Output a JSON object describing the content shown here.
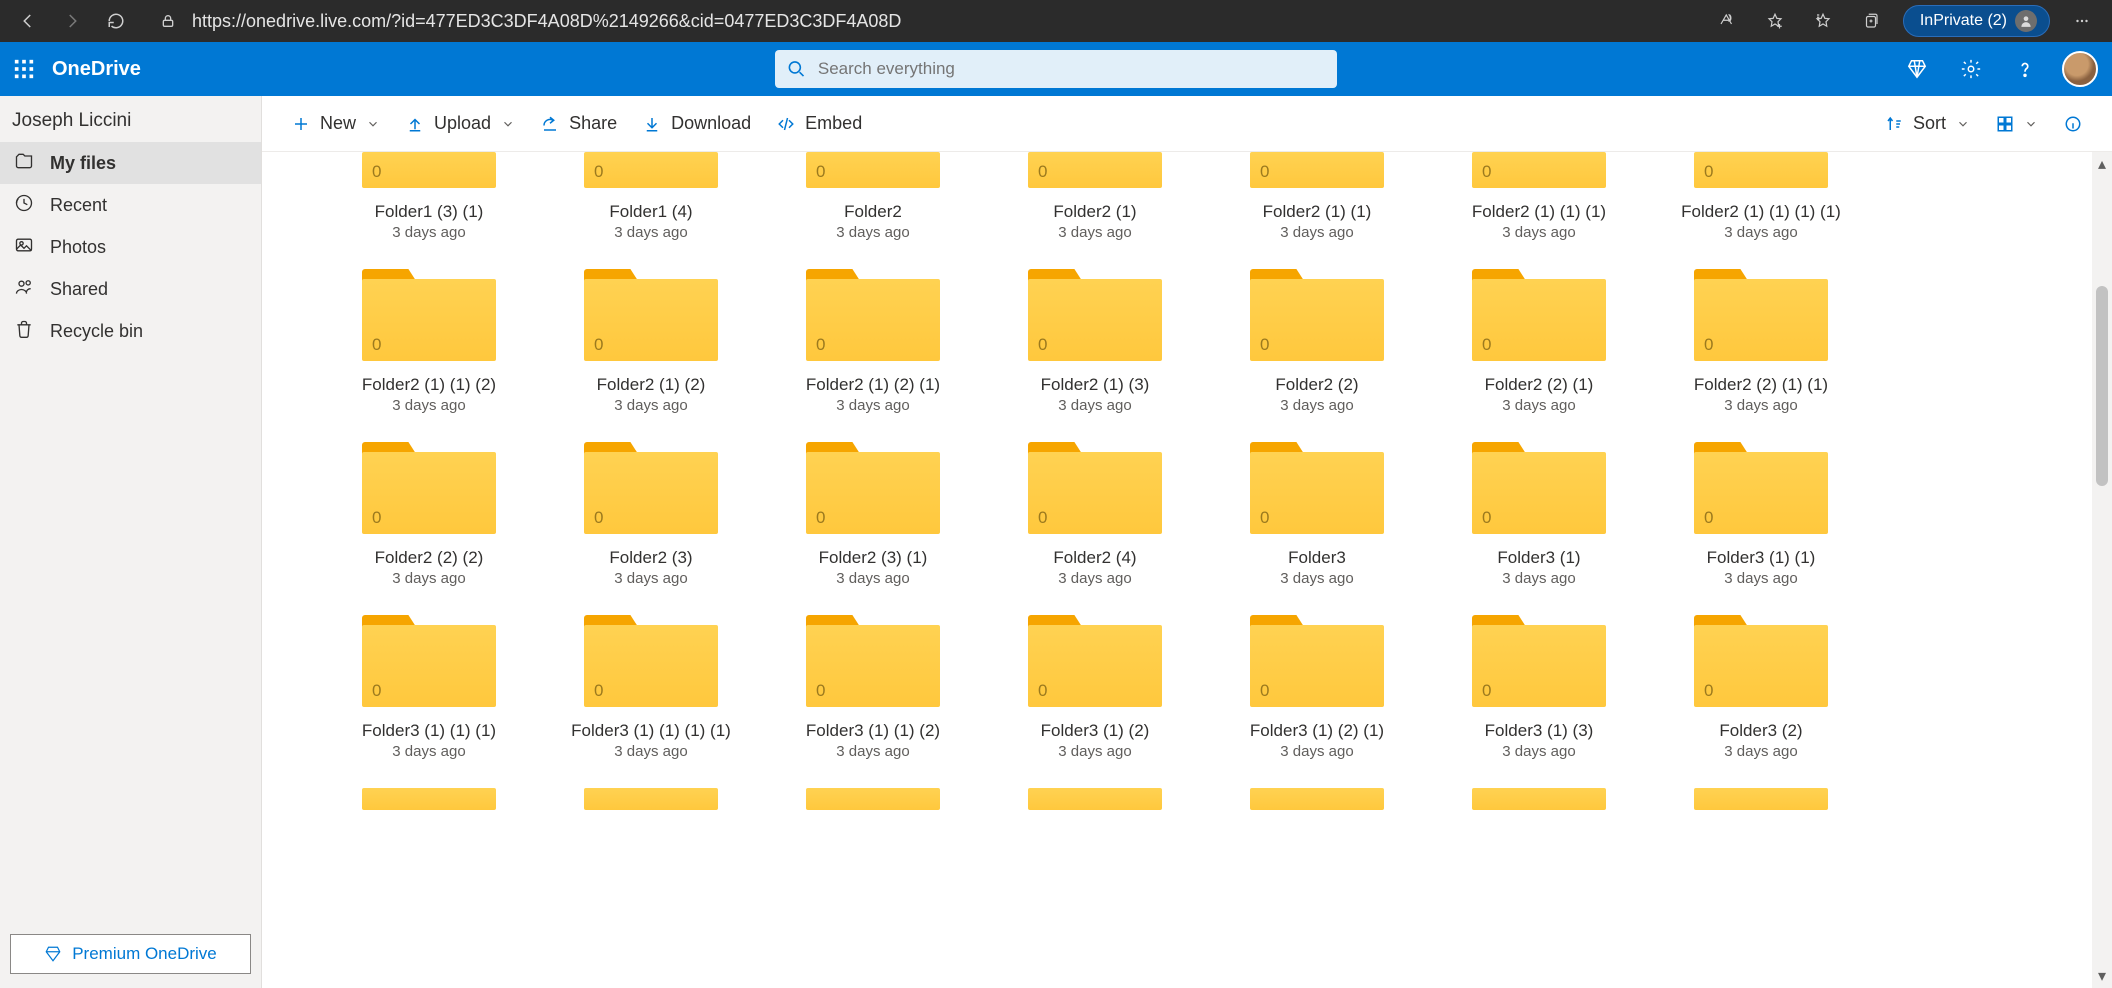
{
  "browser": {
    "url": "https://onedrive.live.com/?id=477ED3C3DF4A08D%2149266&cid=0477ED3C3DF4A08D",
    "inprivate_label": "InPrivate (2)"
  },
  "header": {
    "app_title": "OneDrive",
    "search_placeholder": "Search everything"
  },
  "sidebar": {
    "user": "Joseph Liccini",
    "items": [
      {
        "label": "My files"
      },
      {
        "label": "Recent"
      },
      {
        "label": "Photos"
      },
      {
        "label": "Shared"
      },
      {
        "label": "Recycle bin"
      }
    ],
    "premium_label": "Premium OneDrive"
  },
  "commands": {
    "new": "New",
    "upload": "Upload",
    "share": "Share",
    "download": "Download",
    "embed": "Embed",
    "sort": "Sort"
  },
  "folders": [
    {
      "name": "Folder1 (3) (1)",
      "count": "0",
      "modified": "3 days ago",
      "trunc": true
    },
    {
      "name": "Folder1 (4)",
      "count": "0",
      "modified": "3 days ago",
      "trunc": true
    },
    {
      "name": "Folder2",
      "count": "0",
      "modified": "3 days ago",
      "trunc": true
    },
    {
      "name": "Folder2 (1)",
      "count": "0",
      "modified": "3 days ago",
      "trunc": true
    },
    {
      "name": "Folder2 (1) (1)",
      "count": "0",
      "modified": "3 days ago",
      "trunc": true
    },
    {
      "name": "Folder2 (1) (1) (1)",
      "count": "0",
      "modified": "3 days ago",
      "trunc": true
    },
    {
      "name": "Folder2 (1) (1) (1) (1)",
      "count": "0",
      "modified": "3 days ago",
      "trunc": true
    },
    {
      "name": "Folder2 (1) (1) (2)",
      "count": "0",
      "modified": "3 days ago"
    },
    {
      "name": "Folder2 (1) (2)",
      "count": "0",
      "modified": "3 days ago"
    },
    {
      "name": "Folder2 (1) (2) (1)",
      "count": "0",
      "modified": "3 days ago"
    },
    {
      "name": "Folder2 (1) (3)",
      "count": "0",
      "modified": "3 days ago"
    },
    {
      "name": "Folder2 (2)",
      "count": "0",
      "modified": "3 days ago"
    },
    {
      "name": "Folder2 (2) (1)",
      "count": "0",
      "modified": "3 days ago"
    },
    {
      "name": "Folder2 (2) (1) (1)",
      "count": "0",
      "modified": "3 days ago"
    },
    {
      "name": "Folder2 (2) (2)",
      "count": "0",
      "modified": "3 days ago"
    },
    {
      "name": "Folder2 (3)",
      "count": "0",
      "modified": "3 days ago"
    },
    {
      "name": "Folder2 (3) (1)",
      "count": "0",
      "modified": "3 days ago"
    },
    {
      "name": "Folder2 (4)",
      "count": "0",
      "modified": "3 days ago"
    },
    {
      "name": "Folder3",
      "count": "0",
      "modified": "3 days ago"
    },
    {
      "name": "Folder3 (1)",
      "count": "0",
      "modified": "3 days ago"
    },
    {
      "name": "Folder3 (1) (1)",
      "count": "0",
      "modified": "3 days ago"
    },
    {
      "name": "Folder3 (1) (1) (1)",
      "count": "0",
      "modified": "3 days ago"
    },
    {
      "name": "Folder3 (1) (1) (1) (1)",
      "count": "0",
      "modified": "3 days ago"
    },
    {
      "name": "Folder3 (1) (1) (2)",
      "count": "0",
      "modified": "3 days ago"
    },
    {
      "name": "Folder3 (1) (2)",
      "count": "0",
      "modified": "3 days ago"
    },
    {
      "name": "Folder3 (1) (2) (1)",
      "count": "0",
      "modified": "3 days ago"
    },
    {
      "name": "Folder3 (1) (3)",
      "count": "0",
      "modified": "3 days ago"
    },
    {
      "name": "Folder3 (2)",
      "count": "0",
      "modified": "3 days ago"
    },
    {
      "name": "",
      "count": "",
      "modified": "",
      "peek": true
    },
    {
      "name": "",
      "count": "",
      "modified": "",
      "peek": true
    },
    {
      "name": "",
      "count": "",
      "modified": "",
      "peek": true
    },
    {
      "name": "",
      "count": "",
      "modified": "",
      "peek": true
    },
    {
      "name": "",
      "count": "",
      "modified": "",
      "peek": true
    },
    {
      "name": "",
      "count": "",
      "modified": "",
      "peek": true
    },
    {
      "name": "",
      "count": "",
      "modified": "",
      "peek": true
    }
  ]
}
